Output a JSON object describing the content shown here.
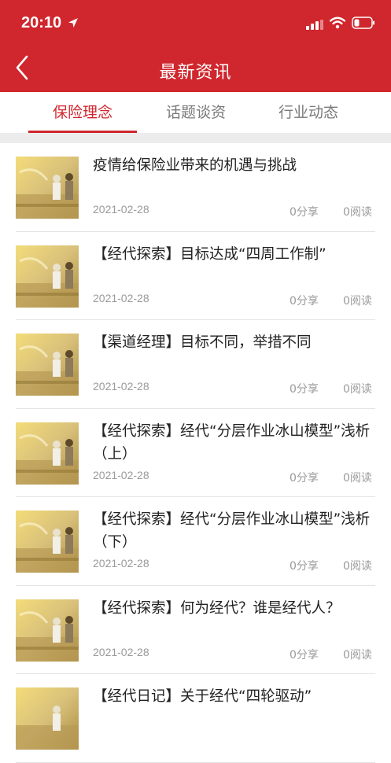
{
  "status_bar": {
    "time": "20:10"
  },
  "header": {
    "title": "最新资讯"
  },
  "tabs": [
    {
      "label": "保险理念",
      "active": true
    },
    {
      "label": "话题谈资",
      "active": false
    },
    {
      "label": "行业动态",
      "active": false
    }
  ],
  "colors": {
    "brand": "#d0262d",
    "active_tab": "#d0262d",
    "meta_text": "#9a9a9a"
  },
  "articles": [
    {
      "title": "疫情给保险业带来的机遇与挑战",
      "date": "2021-02-28",
      "shares": "0分享",
      "reads": "0阅读"
    },
    {
      "title": "【经代探索】目标达成“四周工作制”",
      "date": "2021-02-28",
      "shares": "0分享",
      "reads": "0阅读"
    },
    {
      "title": "【渠道经理】目标不同，举措不同",
      "date": "2021-02-28",
      "shares": "0分享",
      "reads": "0阅读"
    },
    {
      "title": "【经代探索】经代“分层作业冰山模型”浅析（上）",
      "date": "2021-02-28",
      "shares": "0分享",
      "reads": "0阅读"
    },
    {
      "title": "【经代探索】经代“分层作业冰山模型”浅析（下）",
      "date": "2021-02-28",
      "shares": "0分享",
      "reads": "0阅读"
    },
    {
      "title": "【经代探索】何为经代？谁是经代人？",
      "date": "2021-02-28",
      "shares": "0分享",
      "reads": "0阅读"
    },
    {
      "title": "【经代日记】关于经代“四轮驱动”",
      "date": "",
      "shares": "",
      "reads": ""
    }
  ]
}
